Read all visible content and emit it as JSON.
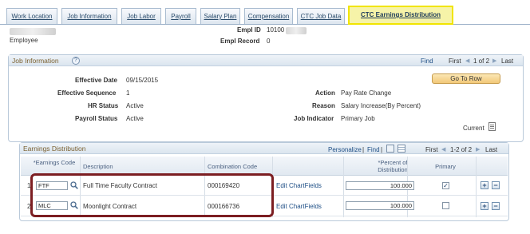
{
  "tabs": [
    {
      "label": "Work Location"
    },
    {
      "label": "Job Information"
    },
    {
      "label": "Job Labor"
    },
    {
      "label": "Payroll"
    },
    {
      "label": "Salary Plan"
    },
    {
      "label": "Compensation"
    },
    {
      "label": "CTC Job Data"
    },
    {
      "label": "CTC Earnings Distribution"
    }
  ],
  "header": {
    "employee_label": "Employee",
    "empl_id_label": "Empl ID",
    "empl_id_value": "10100",
    "empl_record_label": "Empl Record",
    "empl_record_value": "0"
  },
  "job_info": {
    "title": "Job Information",
    "find": "Find",
    "first": "First",
    "paging": "1 of 2",
    "last": "Last",
    "goto_row": "Go To Row",
    "effective_date_label": "Effective Date",
    "effective_date": "09/15/2015",
    "effective_sequence_label": "Effective Sequence",
    "effective_sequence": "1",
    "hr_status_label": "HR Status",
    "hr_status": "Active",
    "payroll_status_label": "Payroll Status",
    "payroll_status": "Active",
    "action_label": "Action",
    "action": "Pay Rate Change",
    "reason_label": "Reason",
    "reason": "Salary Increase(By Percent)",
    "job_indicator_label": "Job Indicator",
    "job_indicator": "Primary Job",
    "current": "Current"
  },
  "earnings": {
    "title": "Earnings Distribution",
    "personalize": "Personalize",
    "sep": "|",
    "find": "Find",
    "first": "First",
    "paging": "1-2 of 2",
    "last": "Last",
    "columns": {
      "earnings_code": "*Earnings Code",
      "description": "Description",
      "combination_code": "Combination Code",
      "percent": "*Percent of Distribution",
      "primary": "Primary"
    },
    "rows": [
      {
        "num": "1",
        "code": "FTF",
        "description": "Full Time Faculty Contract",
        "combination": "000169420",
        "chartfields": "Edit ChartFields",
        "percent": "100.000",
        "primary": "✓"
      },
      {
        "num": "2",
        "code": "MLC",
        "description": "Moonlight Contract",
        "combination": "000166736",
        "chartfields": "Edit ChartFields",
        "percent": "100.000",
        "primary": ""
      }
    ]
  },
  "colors": {
    "active_tab_bg": "#f6f3a8",
    "active_tab_border": "#f1e400",
    "highlight_border": "#7c1e22",
    "link": "#1f4f86",
    "section_title": "#7a6030"
  }
}
